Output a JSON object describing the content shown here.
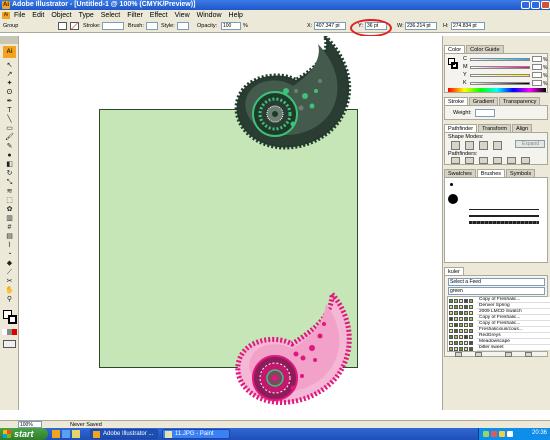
{
  "window": {
    "title": "Adobe Illustrator - [Untitled-1 @ 100% (CMYK/Preview)]"
  },
  "menu": [
    "File",
    "Edit",
    "Object",
    "Type",
    "Select",
    "Filter",
    "Effect",
    "View",
    "Window",
    "Help"
  ],
  "control": {
    "group_label": "Group",
    "stroke_label": "Stroke:",
    "brush_label": "Brush:",
    "style_label": "Style:",
    "opacity_label": "Opacity:",
    "opacity_value": "100",
    "opacity_unit": "%",
    "x_label": "X:",
    "x_value": "407.347 pt",
    "y_label": "Y:",
    "y_value": "36 pt",
    "w_label": "W:",
    "w_value": "236.214 pt",
    "h_label": "H:",
    "h_value": "274.834 pt"
  },
  "panels": {
    "color_tabs": [
      "Color",
      "Color Guide"
    ],
    "cmyk_labels": [
      "C",
      "M",
      "Y",
      "K"
    ],
    "pct_sign": "%",
    "stroke_tabs": [
      "Stroke",
      "Gradient",
      "Transparency"
    ],
    "weight_label": "Weight:",
    "pathfinder_tabs": [
      "Pathfinder",
      "Transform",
      "Align"
    ],
    "shape_modes_label": "Shape Modes:",
    "expand_button": "Expand",
    "pathfinders_label": "Pathfinders:",
    "brush_tabs": [
      "Swatches",
      "Brushes",
      "Symbols"
    ],
    "kuler_tab": "kuler",
    "kuler_select": "Select a Feed",
    "kuler_search": "green",
    "kuler_themes": [
      "Copy of Freshalic...",
      "Denver Spring",
      "2009 LMCD Swatch",
      "Copy of Freshalic...",
      "Copy of Freshalic...",
      "Freshalicious/cous...",
      "RedGreys",
      "Meadowscape",
      "bitter sweet"
    ]
  },
  "status": {
    "zoom": "100%",
    "status_text": "Never Saved"
  },
  "taskbar": {
    "start_label": "start",
    "tasks": [
      "Adobe Illustrator ...",
      "11.JPG - Paint"
    ],
    "clock": "20:36"
  },
  "colors": {
    "artboard_fill": "#c6e6b8",
    "paisley_green_dark": "#1f3a2a",
    "paisley_green_accent": "#3ec27a",
    "paisley_pink": "#e0177d",
    "highlight_red": "#e02020"
  },
  "icons": {
    "tools": [
      "selection-tool-icon",
      "direct-selection-tool-icon",
      "magic-wand-tool-icon",
      "lasso-tool-icon",
      "pen-tool-icon",
      "type-tool-icon",
      "line-tool-icon",
      "rectangle-tool-icon",
      "paintbrush-tool-icon",
      "pencil-tool-icon",
      "blob-brush-tool-icon",
      "eraser-tool-icon",
      "rotate-tool-icon",
      "scale-tool-icon",
      "warp-tool-icon",
      "free-transform-tool-icon",
      "symbol-sprayer-tool-icon",
      "column-graph-tool-icon",
      "mesh-tool-icon",
      "gradient-tool-icon",
      "eyedropper-tool-icon",
      "blend-tool-icon",
      "live-paint-tool-icon",
      "slice-tool-icon",
      "scissors-tool-icon",
      "hand-tool-icon",
      "zoom-tool-icon"
    ]
  }
}
